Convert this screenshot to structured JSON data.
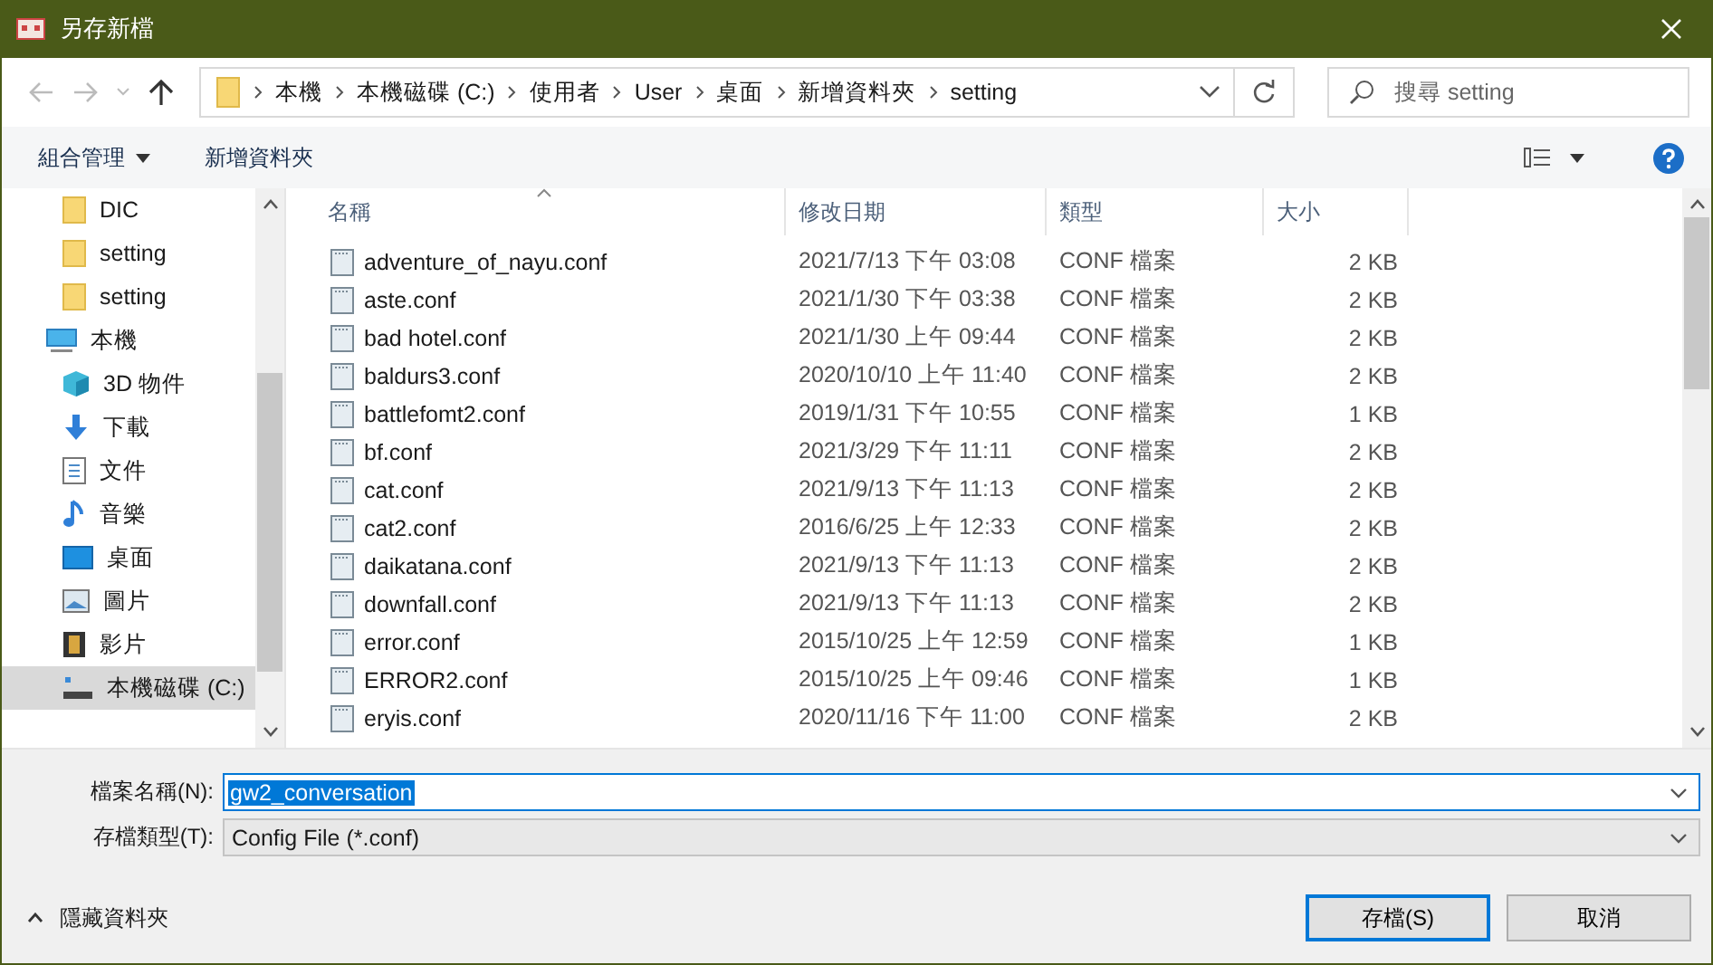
{
  "window": {
    "title": "另存新檔"
  },
  "address_bar": {
    "path": [
      "本機",
      "本機磁碟 (C:)",
      "使用者",
      "User",
      "桌面",
      "新增資料夾",
      "setting"
    ]
  },
  "search": {
    "placeholder": "搜尋 setting"
  },
  "toolbar": {
    "organize": "組合管理",
    "new_folder": "新增資料夾"
  },
  "sidebar": {
    "items": [
      {
        "kind": "folder",
        "label": "DIC",
        "selected": false
      },
      {
        "kind": "folder",
        "label": "setting",
        "selected": false
      },
      {
        "kind": "folder",
        "label": "setting",
        "selected": false
      },
      {
        "kind": "pc",
        "label": "本機",
        "selected": false,
        "children": [
          {
            "kind": "objects3d",
            "label": "3D 物件",
            "selected": false
          },
          {
            "kind": "download",
            "label": "下載",
            "selected": false
          },
          {
            "kind": "document",
            "label": "文件",
            "selected": false
          },
          {
            "kind": "music",
            "label": "音樂",
            "selected": false
          },
          {
            "kind": "desktop",
            "label": "桌面",
            "selected": false
          },
          {
            "kind": "picture",
            "label": "圖片",
            "selected": false
          },
          {
            "kind": "video",
            "label": "影片",
            "selected": false
          },
          {
            "kind": "drive",
            "label": "本機磁碟 (C:)",
            "selected": true
          }
        ]
      }
    ]
  },
  "table": {
    "columns": [
      "名稱",
      "修改日期",
      "類型",
      "大小"
    ],
    "rows": [
      [
        "adventure_of_nayu.conf",
        "2021/7/13 下午 03:08",
        "CONF 檔案",
        "2 KB"
      ],
      [
        "aste.conf",
        "2021/1/30 下午 03:38",
        "CONF 檔案",
        "2 KB"
      ],
      [
        "bad hotel.conf",
        "2021/1/30 上午 09:44",
        "CONF 檔案",
        "2 KB"
      ],
      [
        "baldurs3.conf",
        "2020/10/10 上午 11:40",
        "CONF 檔案",
        "2 KB"
      ],
      [
        "battlefomt2.conf",
        "2019/1/31 下午 10:55",
        "CONF 檔案",
        "1 KB"
      ],
      [
        "bf.conf",
        "2021/3/29 下午 11:11",
        "CONF 檔案",
        "2 KB"
      ],
      [
        "cat.conf",
        "2021/9/13 下午 11:13",
        "CONF 檔案",
        "2 KB"
      ],
      [
        "cat2.conf",
        "2016/6/25 上午 12:33",
        "CONF 檔案",
        "2 KB"
      ],
      [
        "daikatana.conf",
        "2021/9/13 下午 11:13",
        "CONF 檔案",
        "2 KB"
      ],
      [
        "downfall.conf",
        "2021/9/13 下午 11:13",
        "CONF 檔案",
        "2 KB"
      ],
      [
        "error.conf",
        "2015/10/25 上午 12:59",
        "CONF 檔案",
        "1 KB"
      ],
      [
        "ERROR2.conf",
        "2015/10/25 上午 09:46",
        "CONF 檔案",
        "1 KB"
      ],
      [
        "eryis.conf",
        "2020/11/16 下午 11:00",
        "CONF 檔案",
        "2 KB"
      ]
    ]
  },
  "form": {
    "filename_label": "檔案名稱(N):",
    "filename": "gw2_conversation",
    "type_label": "存檔類型(T):",
    "type": "Config File (*.conf)"
  },
  "footer": {
    "hide_folders": "隱藏資料夾",
    "save": "存檔(S)",
    "cancel": "取消"
  }
}
